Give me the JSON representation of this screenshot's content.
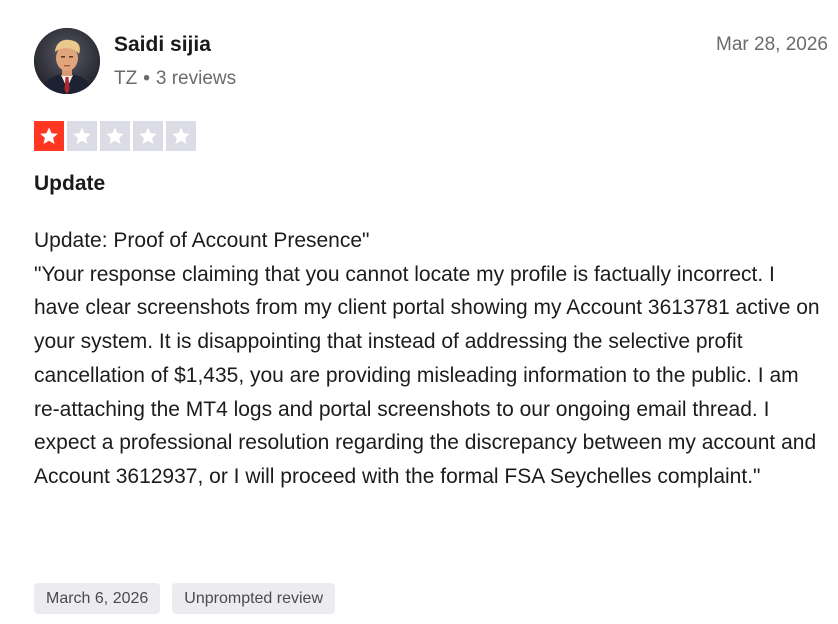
{
  "reviewer": {
    "name": "Saidi sijia",
    "country": "TZ",
    "separator": "•",
    "reviews_count": "3 reviews"
  },
  "review": {
    "date": "Mar 28, 2026",
    "rating": 1,
    "rating_max": 5,
    "title": "Update",
    "body_heading": "Update: Proof of Account Presence\"",
    "body_text": "\"Your response claiming that you cannot locate my profile is factually incorrect. I have clear screenshots from my client portal showing my Account 3613781 active on your system. It is disappointing that instead of addressing the selective profit cancellation of $1,435, you are providing misleading information to the public. I am re-attaching the MT4 logs and portal screenshots to our ongoing email thread. I expect a professional resolution regarding the discrepancy between my account and Account 3612937, or I will proceed with the formal FSA Seychelles complaint.\""
  },
  "tags": {
    "experience_date": "March 6, 2026",
    "review_type": "Unprompted review"
  },
  "icons": {
    "avatar": "user-avatar-photo",
    "star": "star-icon"
  },
  "colors": {
    "star_filled": "#ff3722",
    "star_empty": "#dcdce6",
    "tag_bg": "#ececf0",
    "meta_text": "#6b6b6b"
  }
}
